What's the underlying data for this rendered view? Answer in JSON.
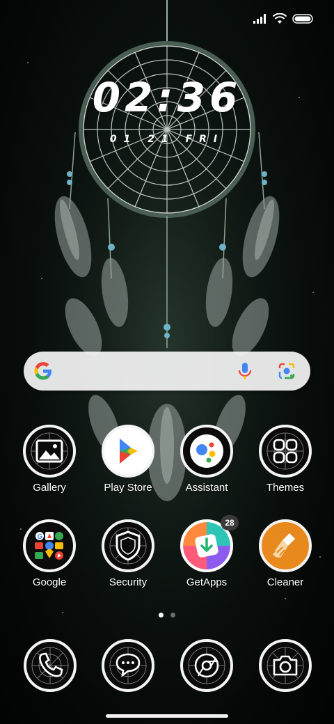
{
  "status_bar": {
    "signal_icon": "signal-bars-icon",
    "wifi_icon": "wifi-icon",
    "battery_icon": "battery-icon"
  },
  "clock": {
    "time": "02:36",
    "date": "01 21 FRI"
  },
  "search": {
    "logo_icon": "google-g-icon",
    "mic_icon": "microphone-icon",
    "lens_icon": "google-lens-icon"
  },
  "apps": {
    "gallery": {
      "label": "Gallery",
      "icon": "gallery-icon"
    },
    "play_store": {
      "label": "Play Store",
      "icon": "play-store-icon"
    },
    "assistant": {
      "label": "Assistant",
      "icon": "assistant-icon"
    },
    "themes": {
      "label": "Themes",
      "icon": "themes-icon"
    },
    "google": {
      "label": "Google",
      "icon": "google-folder-icon"
    },
    "security": {
      "label": "Security",
      "icon": "security-shield-icon"
    },
    "getapps": {
      "label": "GetApps",
      "icon": "getapps-icon",
      "badge": "28"
    },
    "cleaner": {
      "label": "Cleaner",
      "icon": "broom-icon"
    }
  },
  "page_indicator": {
    "count": 2,
    "active": 1
  },
  "dock": {
    "phone": {
      "icon": "phone-icon"
    },
    "messages": {
      "icon": "messages-icon"
    },
    "browser": {
      "icon": "chrome-icon"
    },
    "camera": {
      "icon": "camera-icon"
    }
  },
  "colors": {
    "google_blue": "#4285F4",
    "google_red": "#EA4335",
    "google_yellow": "#FBBC05",
    "google_green": "#34A853",
    "cleaner_orange": "#E8891E"
  }
}
